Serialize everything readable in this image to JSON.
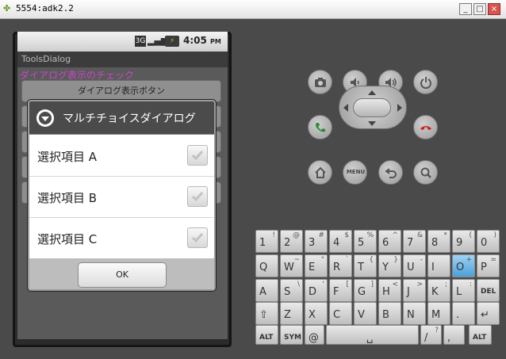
{
  "window": {
    "title": "5554:adk2.2",
    "minimize_label": "_",
    "maximize_label": "□",
    "close_label": "×",
    "app_icon": "android-icon"
  },
  "statusbar": {
    "network_label": "3G",
    "signal_icon": "signal-icon",
    "battery_icon": "battery-icon",
    "time": "4:05",
    "ampm": "PM"
  },
  "app": {
    "title": "ToolsDialog",
    "check_text": "ダイアログ表示のチェック",
    "show_button_label": "ダイアログ表示ボタン"
  },
  "dialog": {
    "title": "マルチチョイスダイアログ",
    "items": [
      {
        "label": "選択項目 A"
      },
      {
        "label": "選択項目 B"
      },
      {
        "label": "選択項目 C"
      }
    ],
    "ok_label": "OK"
  },
  "controls": {
    "menu_label": "MENU"
  },
  "keyboard": {
    "row1": [
      {
        "main": "1",
        "alt": "!"
      },
      {
        "main": "2",
        "alt": "@"
      },
      {
        "main": "3",
        "alt": "#"
      },
      {
        "main": "4",
        "alt": "$"
      },
      {
        "main": "5",
        "alt": "%"
      },
      {
        "main": "6",
        "alt": "^"
      },
      {
        "main": "7",
        "alt": "&"
      },
      {
        "main": "8",
        "alt": "*"
      },
      {
        "main": "9",
        "alt": "("
      },
      {
        "main": "0",
        "alt": ")"
      }
    ],
    "row2": [
      {
        "main": "Q",
        "alt": ""
      },
      {
        "main": "W",
        "alt": "~"
      },
      {
        "main": "E",
        "alt": "\""
      },
      {
        "main": "R",
        "alt": "`"
      },
      {
        "main": "T",
        "alt": "{"
      },
      {
        "main": "Y",
        "alt": "}"
      },
      {
        "main": "U",
        "alt": "-"
      },
      {
        "main": "I",
        "alt": ""
      },
      {
        "main": "O",
        "alt": "+"
      },
      {
        "main": "P",
        "alt": "="
      }
    ],
    "row3": [
      {
        "main": "A",
        "alt": ""
      },
      {
        "main": "S",
        "alt": "\\"
      },
      {
        "main": "D",
        "alt": "'"
      },
      {
        "main": "F",
        "alt": "["
      },
      {
        "main": "G",
        "alt": "]"
      },
      {
        "main": "H",
        "alt": "<"
      },
      {
        "main": "J",
        "alt": ">"
      },
      {
        "main": "K",
        "alt": ";"
      },
      {
        "main": "L",
        "alt": ":"
      },
      {
        "main": "DEL",
        "alt": ""
      }
    ],
    "row4": [
      {
        "main": "⇧",
        "alt": ""
      },
      {
        "main": "Z",
        "alt": ""
      },
      {
        "main": "X",
        "alt": ""
      },
      {
        "main": "C",
        "alt": ""
      },
      {
        "main": "V",
        "alt": ""
      },
      {
        "main": "B",
        "alt": ""
      },
      {
        "main": "N",
        "alt": ""
      },
      {
        "main": "M",
        "alt": ""
      },
      {
        "main": ".",
        "alt": ""
      },
      {
        "main": "↵",
        "alt": ""
      }
    ],
    "row5": [
      {
        "main": "ALT",
        "alt": ""
      },
      {
        "main": "SYM",
        "alt": ""
      },
      {
        "main": "@",
        "alt": ""
      },
      {
        "main": "␣",
        "alt": ""
      },
      {
        "main": "/",
        "alt": "?"
      },
      {
        "main": ",",
        "alt": ""
      },
      {
        "main": "ALT",
        "alt": ""
      }
    ]
  }
}
